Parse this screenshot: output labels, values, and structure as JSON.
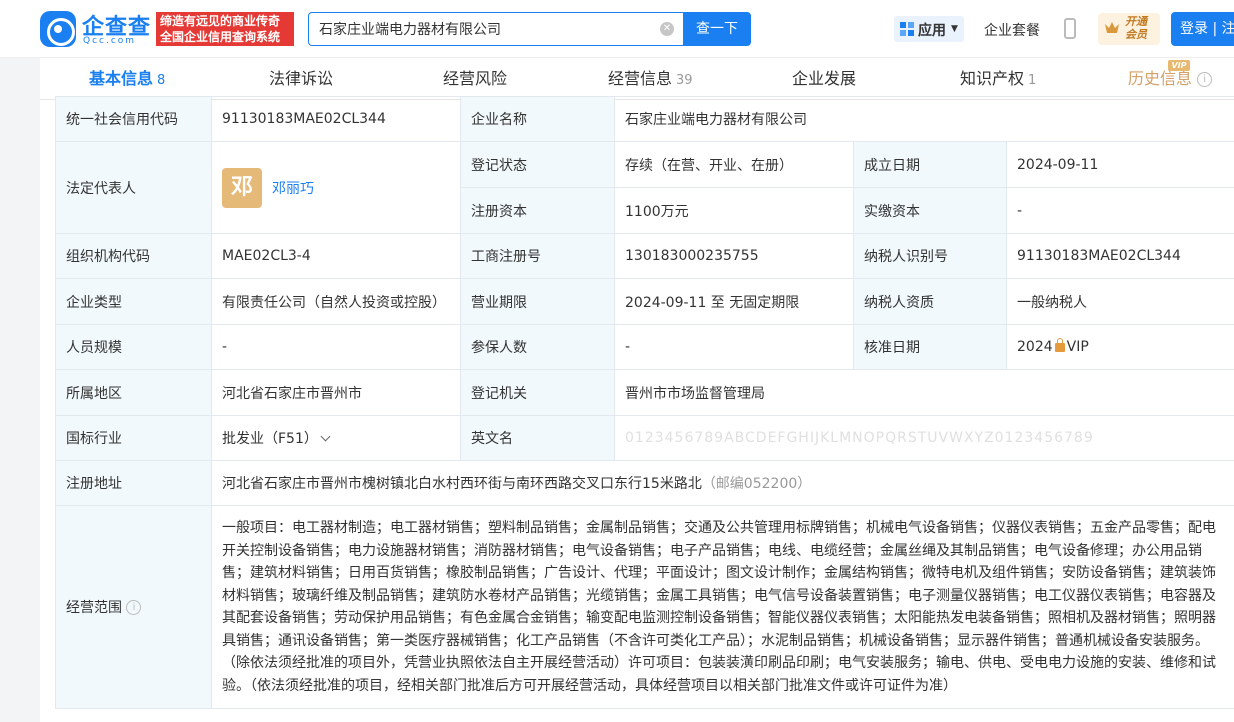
{
  "header": {
    "logo_name": "企查查",
    "logo_domain": "Qcc.com",
    "slogan_line1": "缔造有远见的商业传奇",
    "slogan_line2": "全国企业信用查询系统",
    "search_value": "石家庄业端电力器材有限公司",
    "search_button": "查一下",
    "app_label": "应用",
    "suite_label": "企业套餐",
    "vip_line1": "开通",
    "vip_line2": "会员",
    "login_label": "登录 | 注"
  },
  "tabs": [
    {
      "label": "基本信息",
      "count": "8",
      "active": true
    },
    {
      "label": "法律诉讼",
      "count": ""
    },
    {
      "label": "经营风险",
      "count": ""
    },
    {
      "label": "经营信息",
      "count": "39"
    },
    {
      "label": "企业发展",
      "count": ""
    },
    {
      "label": "知识产权",
      "count": "1"
    },
    {
      "label": "历史信息",
      "count": "",
      "badge": "VIP"
    }
  ],
  "info": {
    "credit_code_label": "统一社会信用代码",
    "credit_code": "91130183MAE02CL344",
    "name_label": "企业名称",
    "name": "石家庄业端电力器材有限公司",
    "legal_rep_label": "法定代表人",
    "legal_rep_avatar": "邓",
    "legal_rep": "邓丽巧",
    "reg_status_label": "登记状态",
    "reg_status": "存续（在营、开业、在册）",
    "established_label": "成立日期",
    "established": "2024-09-11",
    "reg_capital_label": "注册资本",
    "reg_capital": "1100万元",
    "paid_capital_label": "实缴资本",
    "paid_capital": "-",
    "org_code_label": "组织机构代码",
    "org_code": "MAE02CL3-4",
    "biz_reg_no_label": "工商注册号",
    "biz_reg_no": "130183000235755",
    "taxpayer_id_label": "纳税人识别号",
    "taxpayer_id": "91130183MAE02CL344",
    "company_type_label": "企业类型",
    "company_type": "有限责任公司（自然人投资或控股）",
    "term_label": "营业期限",
    "term": "2024-09-11 至 无固定期限",
    "taxpayer_qual_label": "纳税人资质",
    "taxpayer_qual": "一般纳税人",
    "staff_size_label": "人员规模",
    "staff_size": "-",
    "insured_label": "参保人数",
    "insured": "-",
    "approval_date_label": "核准日期",
    "approval_date_masked": "VIP",
    "region_label": "所属地区",
    "region": "河北省石家庄市晋州市",
    "authority_label": "登记机关",
    "authority": "晋州市市场监督管理局",
    "industry_label": "国标行业",
    "industry": "批发业（F51）",
    "english_name_label": "英文名",
    "english_name_masked": "0123456789ABCDEFGHIJKLMNOPQRSTUVWXYZ0123456789",
    "address_label": "注册地址",
    "address": "河北省石家庄市晋州市槐树镇北白水村西环街与南环西路交叉口东行15米路北",
    "postcode": "（邮编052200）",
    "scope_label": "经营范围",
    "scope": "一般项目：电工器材制造；电工器材销售；塑料制品销售；金属制品销售；交通及公共管理用标牌销售；机械电气设备销售；仪器仪表销售；五金产品零售；配电开关控制设备销售；电力设施器材销售；消防器材销售；电气设备销售；电子产品销售；电线、电缆经营；金属丝绳及其制品销售；电气设备修理；办公用品销售；建筑材料销售；日用百货销售；橡胶制品销售；广告设计、代理；平面设计；图文设计制作；金属结构销售；微特电机及组件销售；安防设备销售；建筑装饰材料销售；玻璃纤维及制品销售；建筑防水卷材产品销售；光缆销售；金属工具销售；电气信号设备装置销售；电子测量仪器销售；电工仪器仪表销售；电容器及其配套设备销售；劳动保护用品销售；有色金属合金销售；输变配电监测控制设备销售；智能仪器仪表销售；太阳能热发电装备销售；照相机及器材销售；照明器具销售；通讯设备销售；第一类医疗器械销售；化工产品销售（不含许可类化工产品）；水泥制品销售；机械设备销售；显示器件销售；普通机械设备安装服务。（除依法须经批准的项目外，凭营业执照依法自主开展经营活动）许可项目：包装装潢印刷品印刷；电气安装服务；输电、供电、受电电力设施的安装、维修和试验。（依法须经批准的项目，经相关部门批准后方可开展经营活动，具体经营项目以相关部门批准文件或许可证件为准）"
  }
}
